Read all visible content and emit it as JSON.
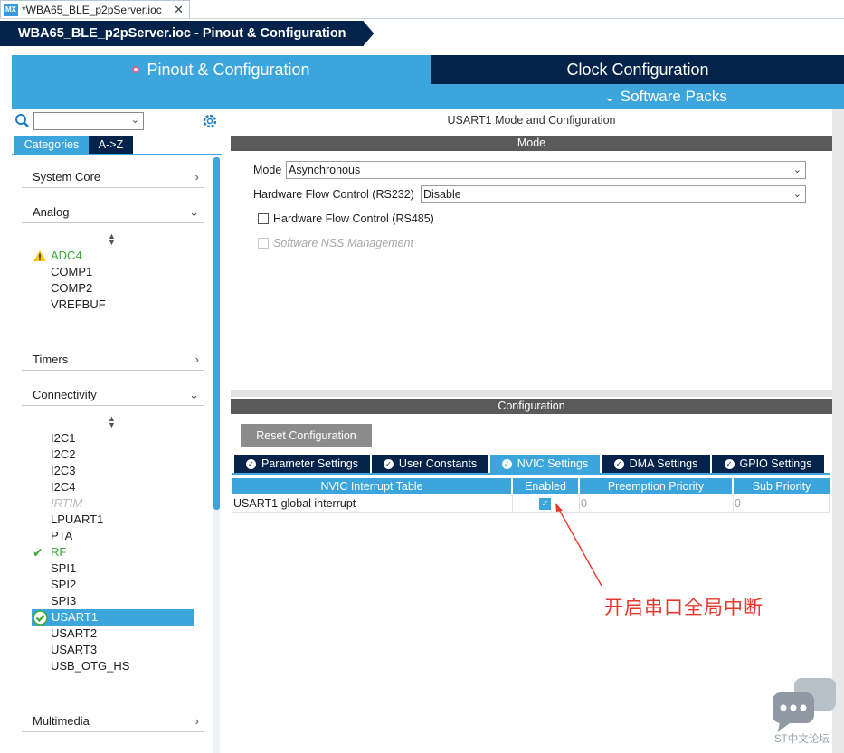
{
  "window": {
    "file_tab_label": "*WBA65_BLE_p2pServer.ioc",
    "mx_badge": "MX",
    "close_glyph": "✕",
    "breadcrumb": "WBA65_BLE_p2pServer.ioc - Pinout & Configuration"
  },
  "main_tabs": {
    "pinout": "Pinout & Configuration",
    "clock": "Clock Configuration",
    "software_packs": "Software Packs",
    "software_packs_chevron": "⌵"
  },
  "left": {
    "search_placeholder": "",
    "tab_categories": "Categories",
    "tab_az": "A->Z",
    "categories": {
      "system_core": "System Core",
      "analog": "Analog",
      "timers": "Timers",
      "connectivity": "Connectivity",
      "multimedia": "Multimedia"
    },
    "analog_items": [
      "ADC4",
      "COMP1",
      "COMP2",
      "VREFBUF"
    ],
    "connectivity_items": [
      "I2C1",
      "I2C2",
      "I2C3",
      "I2C4",
      "IRTIM",
      "LPUART1",
      "PTA",
      "RF",
      "SPI1",
      "SPI2",
      "SPI3",
      "USART1",
      "USART2",
      "USART3",
      "USB_OTG_HS"
    ],
    "selected": "USART1"
  },
  "mode": {
    "title": "USART1 Mode and Configuration",
    "section": "Mode",
    "mode_label": "Mode",
    "mode_value": "Asynchronous",
    "hfc232_label": "Hardware Flow Control (RS232)",
    "hfc232_value": "Disable",
    "hfc485_label": "Hardware Flow Control (RS485)",
    "hfc485_checked": false,
    "nss_label": "Software NSS Management",
    "nss_checked": false
  },
  "config": {
    "section": "Configuration",
    "reset_button": "Reset Configuration",
    "tabs": [
      "Parameter Settings",
      "User Constants",
      "NVIC Settings",
      "DMA Settings",
      "GPIO Settings"
    ],
    "active_tab": "NVIC Settings",
    "table": {
      "headers": [
        "NVIC Interrupt Table",
        "Enabled",
        "Preemption Priority",
        "Sub Priority"
      ],
      "rows": [
        {
          "name": "USART1 global interrupt",
          "enabled": true,
          "preemption": "0",
          "sub": "0"
        }
      ]
    }
  },
  "annotation": "开启串口全局中断",
  "watermark": "ST中文论坛",
  "colors": {
    "accent": "#3ca5dc",
    "navy": "#03234b",
    "green": "#3aaa35",
    "annotation_red": "#e8382e"
  }
}
